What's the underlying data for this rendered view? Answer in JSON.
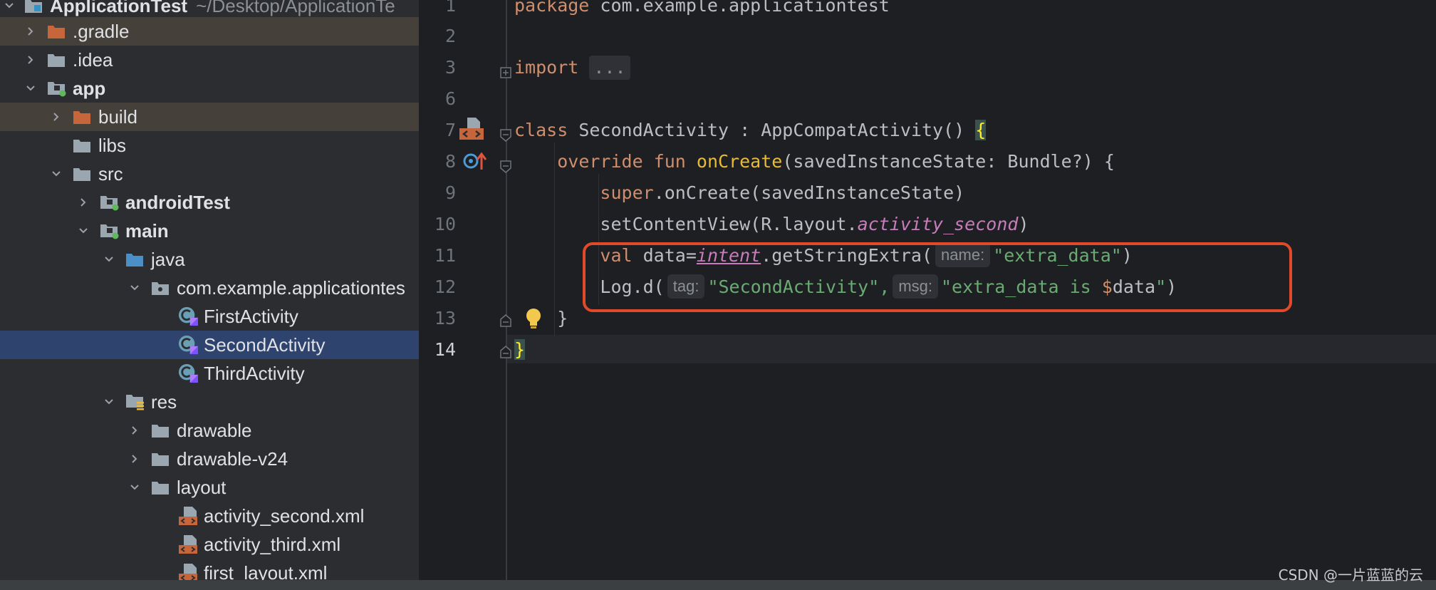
{
  "project_tree": {
    "root": {
      "label": "ApplicationTest",
      "path": "~/Desktop/ApplicationTe"
    },
    "nodes": [
      {
        "label": ".gradle"
      },
      {
        "label": ".idea"
      },
      {
        "label": "app"
      },
      {
        "label": "build"
      },
      {
        "label": "libs"
      },
      {
        "label": "src"
      },
      {
        "label": "androidTest"
      },
      {
        "label": "main"
      },
      {
        "label": "java"
      },
      {
        "label": "com.example.applicationtes"
      },
      {
        "label": "FirstActivity"
      },
      {
        "label": "SecondActivity"
      },
      {
        "label": "ThirdActivity"
      },
      {
        "label": "res"
      },
      {
        "label": "drawable"
      },
      {
        "label": "drawable-v24"
      },
      {
        "label": "layout"
      },
      {
        "label": "activity_second.xml"
      },
      {
        "label": "activity_third.xml"
      },
      {
        "label": "first_layout.xml"
      }
    ]
  },
  "editor": {
    "line_numbers": [
      "1",
      "2",
      "3",
      "6",
      "7",
      "8",
      "9",
      "10",
      "11",
      "12",
      "13",
      "14"
    ],
    "current_line": "14",
    "code": {
      "l1_kw": "package",
      "l1_pkg": " com.example.applicationtest",
      "l3_kw": "import",
      "l3_collapsed": "...",
      "l7_kw": "class",
      "l7_rest": " SecondActivity : AppCompatActivity() ",
      "l7_brace": "{",
      "l8_kw1": "override",
      "l8_kw2": "fun",
      "l8_fn": "onCreate",
      "l8_rest": "(savedInstanceState: Bundle?) {",
      "l9_kw": "super",
      "l9_rest": ".onCreate(savedInstanceState)",
      "l10_a": "setContentView(R.layout.",
      "l10_b": "activity_second",
      "l10_c": ")",
      "l11_kw": "val",
      "l11_a": " data=",
      "l11_b": "intent",
      "l11_c": ".getStringExtra(",
      "l11_hint": "name:",
      "l11_str": "\"extra_data\"",
      "l11_d": ")",
      "l12_a": "Log.d(",
      "l12_hint1": "tag:",
      "l12_str1": "\"SecondActivity\",",
      "l12_hint2": "msg:",
      "l12_str2": "\"extra_data is ",
      "l12_dollar": "$",
      "l12_var": "data",
      "l12_str3": "\"",
      "l12_b": ")",
      "l13": "}",
      "l14": "}"
    }
  },
  "watermark": "CSDN @一片蓝蓝的云",
  "colors": {
    "keyword": "#cf8e6d",
    "string": "#6aab73",
    "function_decl": "#e8ba36",
    "property": "#c77dbb",
    "highlight_box": "#e04a2b",
    "selection": "#2e436e"
  }
}
